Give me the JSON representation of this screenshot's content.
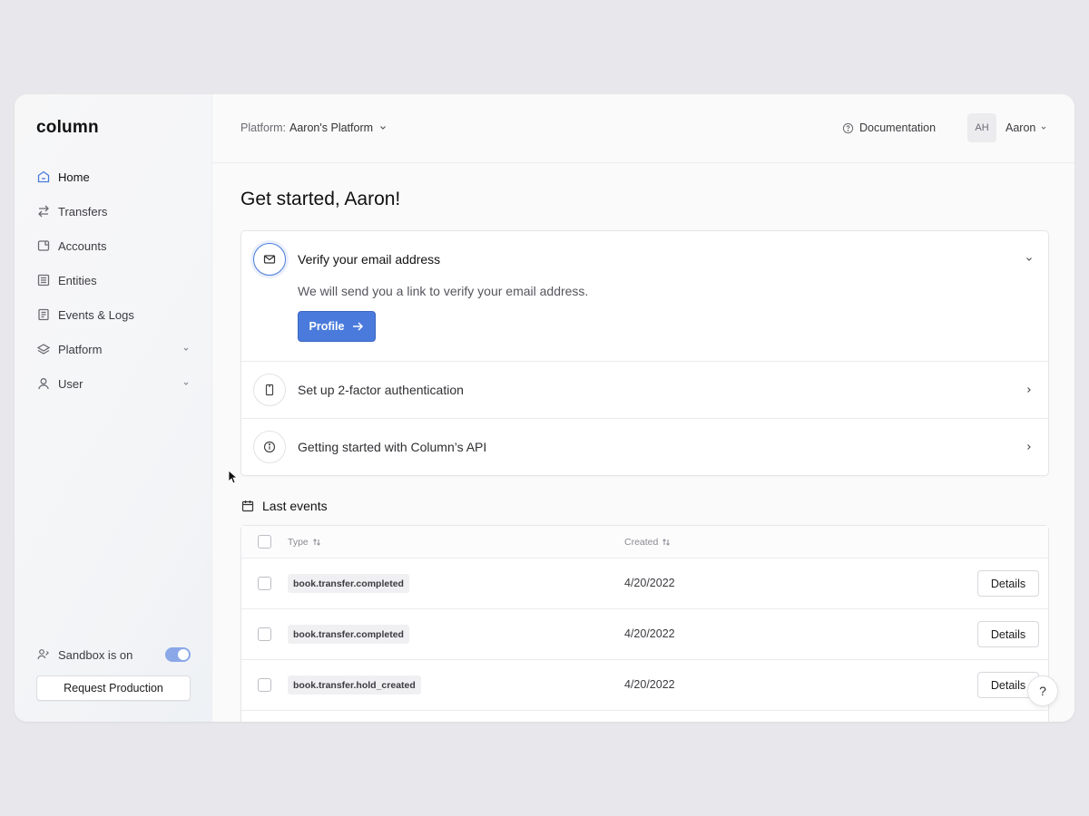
{
  "app": {
    "logo": "column"
  },
  "sidebar": {
    "items": [
      {
        "label": "Home",
        "icon": "home-icon",
        "active": true
      },
      {
        "label": "Transfers",
        "icon": "arrows-swap-icon"
      },
      {
        "label": "Accounts",
        "icon": "wallet-icon"
      },
      {
        "label": "Entities",
        "icon": "building-icon"
      },
      {
        "label": "Events & Logs",
        "icon": "list-icon"
      },
      {
        "label": "Platform",
        "icon": "layers-icon",
        "expandable": true
      },
      {
        "label": "User",
        "icon": "user-icon",
        "expandable": true
      }
    ],
    "sandbox_label": "Sandbox is on",
    "sandbox_on": true,
    "request_production_label": "Request Production"
  },
  "topbar": {
    "platform_prefix": "Platform:",
    "platform_value": "Aaron's Platform",
    "documentation_label": "Documentation",
    "avatar_initials": "AH",
    "user_name": "Aaron"
  },
  "main": {
    "heading": "Get started, Aaron!",
    "steps": [
      {
        "title": "Verify your email address",
        "description": "We will send you a link to verify your email address.",
        "button_label": "Profile",
        "icon": "mail-icon",
        "open": true
      },
      {
        "title": "Set up 2-factor authentication",
        "icon": "phone-icon"
      },
      {
        "title": "Getting started with Column’s API",
        "icon": "info-icon"
      }
    ],
    "events": {
      "title": "Last events",
      "columns": {
        "type": "Type",
        "created": "Created"
      },
      "rows": [
        {
          "type": "book.transfer.completed",
          "created": "4/20/2022",
          "action": "Details"
        },
        {
          "type": "book.transfer.completed",
          "created": "4/20/2022",
          "action": "Details"
        },
        {
          "type": "book.transfer.hold_created",
          "created": "4/20/2022",
          "action": "Details"
        }
      ]
    }
  },
  "help_label": "?",
  "colors": {
    "accent": "#4a7bdc",
    "toggle": "#8aa8e8",
    "background": "#e8e8ec"
  }
}
